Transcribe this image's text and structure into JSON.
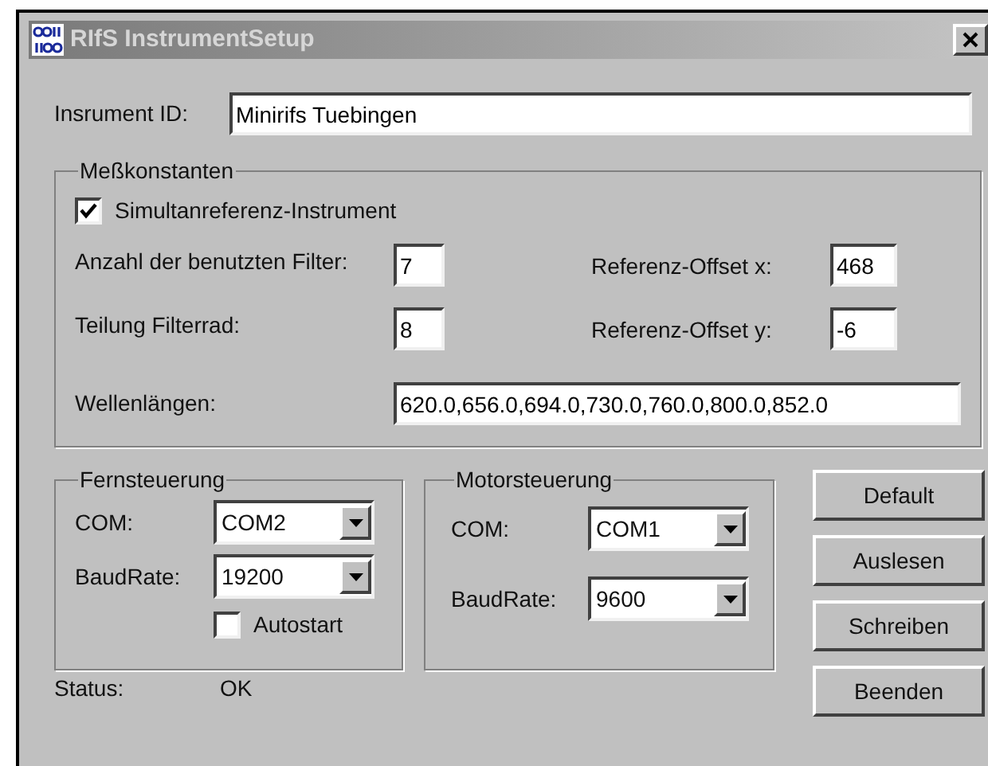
{
  "window": {
    "title": "RIfS InstrumentSetup"
  },
  "instrument_id": {
    "label": "Insrument ID:",
    "value": "Minirifs Tuebingen"
  },
  "messkonstanten": {
    "title": "Meßkonstanten",
    "checkbox": {
      "label": "Simultanreferenz-Instrument",
      "checked": true
    },
    "rows": [
      [
        {
          "label": "Anzahl der benutzten Filter:",
          "value": "7"
        },
        {
          "label": "Referenz-Offset x:",
          "value": "468"
        }
      ],
      [
        {
          "label": "Teilung Filterrad:",
          "value": "8"
        },
        {
          "label": "Referenz-Offset y:",
          "value": "-6"
        }
      ]
    ],
    "wavelengths": {
      "label": "Wellenlängen:",
      "value": "620.0,656.0,694.0,730.0,760.0,800.0,852.0"
    }
  },
  "fernsteuerung": {
    "title": "Fernsteuerung",
    "com": {
      "label": "COM:",
      "value": "COM2"
    },
    "baudrate": {
      "label": "BaudRate:",
      "value": "19200"
    },
    "autostart": {
      "label": "Autostart",
      "checked": false
    }
  },
  "motorsteuerung": {
    "title": "Motorsteuerung",
    "com": {
      "label": "COM:",
      "value": "COM1"
    },
    "baudrate": {
      "label": "BaudRate:",
      "value": "9600"
    }
  },
  "buttons": [
    "Default",
    "Auslesen",
    "Schreiben",
    "Beenden"
  ],
  "status": {
    "label": "Status:",
    "value": "OK"
  }
}
